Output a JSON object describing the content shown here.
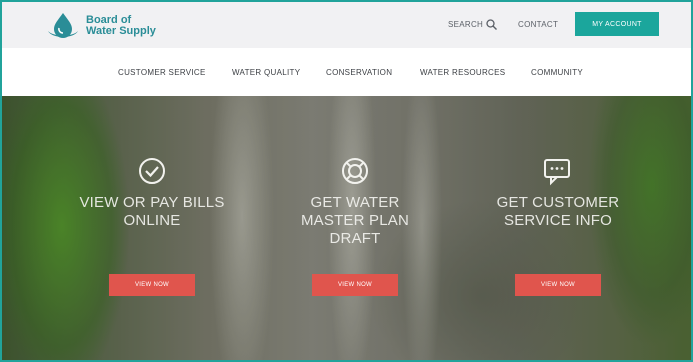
{
  "header": {
    "logo_line1": "Board of",
    "logo_line2": "Water Supply",
    "search_label": "SEARCH",
    "contact_label": "CONTACT",
    "account_label": "MY ACCOUNT"
  },
  "nav": {
    "items": [
      {
        "label": "CUSTOMER SERVICE"
      },
      {
        "label": "WATER QUALITY"
      },
      {
        "label": "CONSERVATION"
      },
      {
        "label": "WATER RESOURCES"
      },
      {
        "label": "COMMUNITY"
      }
    ]
  },
  "hero": {
    "ctas": [
      {
        "icon": "checkmark-icon",
        "title_line1": "VIEW OR PAY BILLS",
        "title_line2": "ONLINE",
        "title_line3": "",
        "button": "VIEW NOW"
      },
      {
        "icon": "lifebuoy-icon",
        "title_line1": "GET WATER",
        "title_line2": "MASTER PLAN",
        "title_line3": "DRAFT",
        "button": "VIEW NOW"
      },
      {
        "icon": "chat-bubble-icon",
        "title_line1": "GET CUSTOMER",
        "title_line2": "SERVICE INFO",
        "title_line3": "",
        "button": "VIEW NOW"
      }
    ]
  },
  "colors": {
    "accent": "#1ba69c",
    "button": "#e0554d",
    "frame": "#21a39b"
  }
}
